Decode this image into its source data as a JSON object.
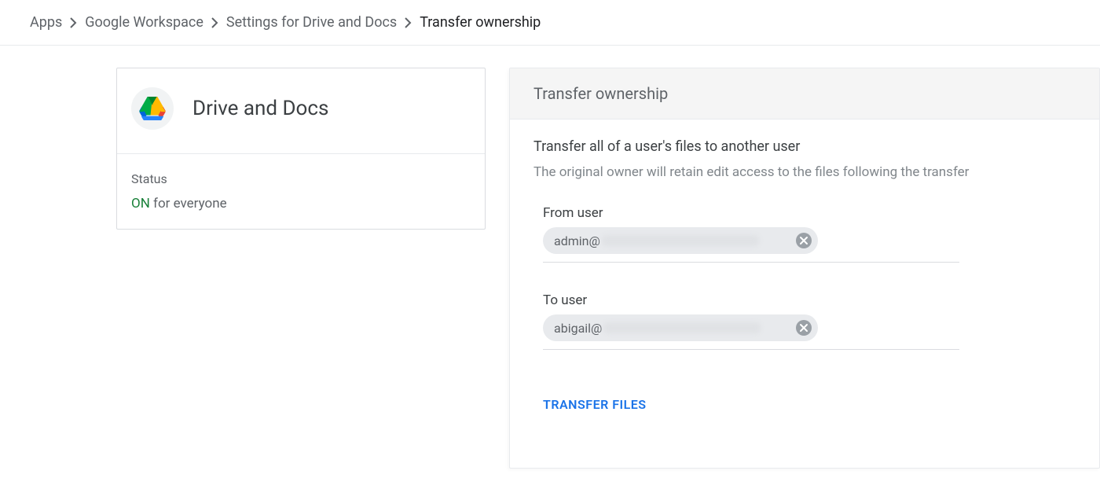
{
  "breadcrumb": {
    "items": [
      {
        "label": "Apps"
      },
      {
        "label": "Google Workspace"
      },
      {
        "label": "Settings for Drive and Docs"
      },
      {
        "label": "Transfer ownership"
      }
    ]
  },
  "left_panel": {
    "title": "Drive and Docs",
    "status_label": "Status",
    "status_on": "ON",
    "status_scope": "for everyone",
    "icon": "google-drive-icon"
  },
  "right_panel": {
    "header": "Transfer ownership",
    "heading": "Transfer all of a user's files to another user",
    "subheading": "The original owner will retain edit access to the files following the transfer",
    "from_label": "From user",
    "from_value_prefix": "admin@",
    "to_label": "To user",
    "to_value_prefix": "abigail@",
    "transfer_button": "TRANSFER FILES"
  }
}
